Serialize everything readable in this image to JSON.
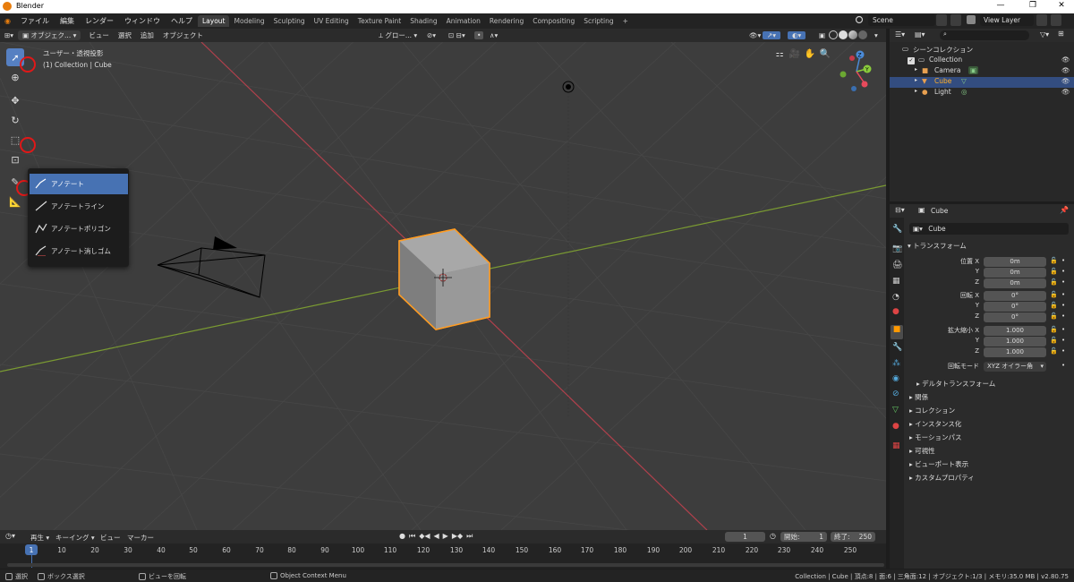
{
  "titlebar": {
    "title": "Blender",
    "min": "—",
    "max": "❐",
    "close": "✕"
  },
  "menubar": {
    "menus": [
      "ファイル",
      "編集",
      "レンダー",
      "ウィンドウ",
      "ヘルプ"
    ],
    "workspaces": [
      "Layout",
      "Modeling",
      "Sculpting",
      "UV Editing",
      "Texture Paint",
      "Shading",
      "Animation",
      "Rendering",
      "Compositing",
      "Scripting"
    ],
    "add_tab": "+",
    "scene": "Scene",
    "view_layer": "View Layer"
  },
  "header3d": {
    "mode": "オブジェク...",
    "menus": [
      "ビュー",
      "選択",
      "追加",
      "オブジェクト"
    ],
    "orientation": "グロー..."
  },
  "viewport_info": {
    "line1": "ユーザー・透視投影",
    "line2": "(1) Collection | Cube"
  },
  "gizmo": {
    "z": "Z",
    "y": "Y"
  },
  "tool_popup": {
    "items": [
      "アノテート",
      "アノテートライン",
      "アノテートポリゴン",
      "アノテート消しゴム"
    ]
  },
  "outliner": {
    "root": "シーンコレクション",
    "collection": "Collection",
    "items": [
      "Camera",
      "Cube",
      "Light"
    ]
  },
  "properties": {
    "object_name": "Cube",
    "data_name": "Cube",
    "transform_label": "トランスフォーム",
    "location_label": "位置 X",
    "rotation_label": "回転 X",
    "scale_label": "拡大縮小 X",
    "y": "Y",
    "z": "Z",
    "loc": [
      "0m",
      "0m",
      "0m"
    ],
    "rot": [
      "0°",
      "0°",
      "0°"
    ],
    "scale": [
      "1.000",
      "1.000",
      "1.000"
    ],
    "rotation_mode_label": "回転モード",
    "rotation_mode": "XYZ オイラー角",
    "delta": "デルタトランスフォーム",
    "sections": [
      "関係",
      "コレクション",
      "インスタンス化",
      "モーションパス",
      "可視性",
      "ビューポート表示",
      "カスタムプロパティ"
    ]
  },
  "timeline": {
    "menus": [
      "再生",
      "キーイング",
      "ビュー",
      "マーカー"
    ],
    "current_frame": "1",
    "start_label": "開始:",
    "start": "1",
    "end_label": "終了:",
    "end": "250",
    "ticks": [
      "1",
      "10",
      "20",
      "30",
      "40",
      "50",
      "60",
      "70",
      "80",
      "90",
      "100",
      "110",
      "120",
      "130",
      "140",
      "150",
      "160",
      "170",
      "180",
      "190",
      "200",
      "210",
      "220",
      "230",
      "240",
      "250"
    ]
  },
  "statusbar": {
    "select": "選択",
    "box_select": "ボックス選択",
    "rotate_view": "ビューを回転",
    "context_menu": "Object Context Menu",
    "stats": "Collection | Cube | 頂点:8 | 面:6 | 三角面:12 | オブジェクト:1/3 | メモリ:35.0 MB | v2.80.75"
  },
  "colors": {
    "accent": "#4772b3",
    "selection": "#ff9c22",
    "red_axis": "#cc4050",
    "green_axis": "#86a336",
    "annotation_circle": "#e01818"
  }
}
